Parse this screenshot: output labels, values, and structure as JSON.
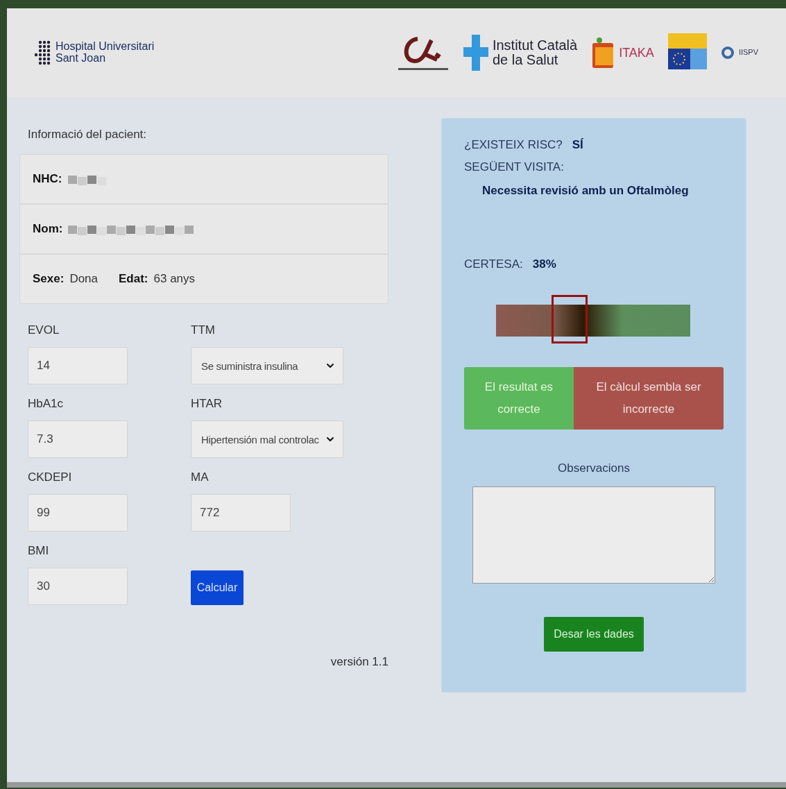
{
  "header": {
    "logos": [
      {
        "kind": "hospital",
        "lines": [
          "Hospital Universitari",
          "Sant Joan"
        ]
      },
      {
        "kind": "university"
      },
      {
        "kind": "ics",
        "lines": [
          "Institut Català",
          "de la Salut"
        ]
      },
      {
        "kind": "itaka",
        "lines": [
          "ITAKA"
        ]
      },
      {
        "kind": "eu"
      },
      {
        "kind": "iispv",
        "lines": [
          "IISPV"
        ]
      }
    ]
  },
  "patient": {
    "title": "Informació del pacient:",
    "nhc_label": "NHC:",
    "name_label": "Nom:",
    "sex_label": "Sexe:",
    "sex_value": "Dona",
    "age_label": "Edat:",
    "age_value": "63 anys"
  },
  "fields": [
    {
      "kind": "input",
      "label": "EVOL",
      "value": "14"
    },
    {
      "kind": "select",
      "label": "TTM",
      "value": "Se suministra insulina"
    },
    {
      "kind": "input",
      "label": "HbA1c",
      "value": "7.3"
    },
    {
      "kind": "select",
      "label": "HTAR",
      "value": "Hipertensión mal controlac"
    },
    {
      "kind": "input",
      "label": "CKDEPI",
      "value": "99"
    },
    {
      "kind": "input",
      "label": "MA",
      "value": "772"
    },
    {
      "kind": "input",
      "label": "BMI",
      "value": "30"
    },
    {
      "kind": "button",
      "label": "Calcular"
    }
  ],
  "version": "versión 1.1",
  "result": {
    "risk_label": "¿EXISTEIX RISC?",
    "risk_value": "SÍ",
    "next_label": "SEGÜENT VISITA:",
    "next_value": "Necessita revisió amb un Oftalmòleg",
    "certainty_label": "CERTESA:",
    "certainty_value": "38%",
    "gauge": {
      "level": 0.38
    },
    "feedback": [
      {
        "kind": "correct",
        "label": "El resultat es correcte"
      },
      {
        "kind": "incorrect",
        "label": "El càlcul sembla ser incorrecte"
      }
    ],
    "observations_label": "Observacions",
    "save": "Desar les dades"
  }
}
